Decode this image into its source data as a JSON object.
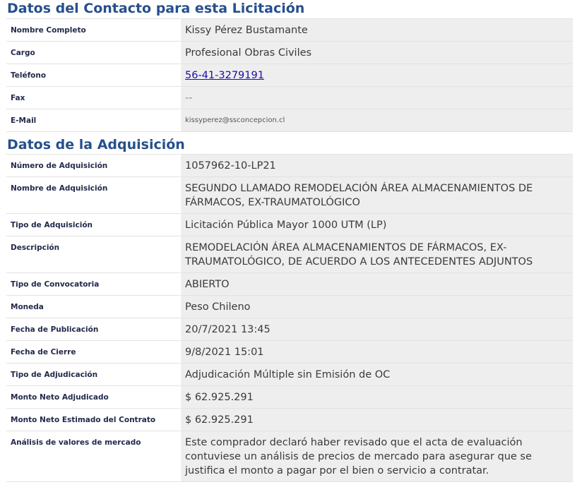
{
  "contact": {
    "title": "Datos del Contacto para esta Licitación",
    "rows": [
      {
        "label": "Nombre Completo",
        "value": "Kissy Pérez Bustamante"
      },
      {
        "label": "Cargo",
        "value": "Profesional Obras Civiles"
      },
      {
        "label": "Teléfono",
        "value": "56-41-3279191"
      },
      {
        "label": "Fax",
        "value": "--"
      },
      {
        "label": "E-Mail",
        "value": "kissyperez@ssconcepcion.cl"
      }
    ]
  },
  "acquisition": {
    "title": "Datos de la Adquisición",
    "rows": [
      {
        "label": "Número de Adquisición",
        "value": "1057962-10-LP21"
      },
      {
        "label": "Nombre de Adquisición",
        "value": "SEGUNDO LLAMADO REMODELACIÓN ÁREA ALMACENAMIENTOS DE FÁRMACOS, EX-TRAUMATOLÓGICO"
      },
      {
        "label": "Tipo de Adquisición",
        "value": "Licitación Pública Mayor 1000 UTM (LP)"
      },
      {
        "label": "Descripción",
        "value": "REMODELACIÓN ÁREA ALMACENAMIENTOS DE FÁRMACOS, EX-TRAUMATOLÓGICO, DE ACUERDO A LOS ANTECEDENTES ADJUNTOS"
      },
      {
        "label": "Tipo de Convocatoria",
        "value": "ABIERTO"
      },
      {
        "label": "Moneda",
        "value": "Peso Chileno"
      },
      {
        "label": "Fecha de Publicación",
        "value": "20/7/2021 13:45"
      },
      {
        "label": "Fecha de Cierre",
        "value": "9/8/2021 15:01"
      },
      {
        "label": "Tipo de Adjudicación",
        "value": "Adjudicación Múltiple sin Emisión de OC"
      },
      {
        "label": "Monto Neto Adjudicado",
        "value": "$ 62.925.291"
      },
      {
        "label": "Monto Neto Estimado del Contrato",
        "value": "$ 62.925.291"
      },
      {
        "label": "Análisis de valores de mercado",
        "value": "Este comprador declaró haber revisado que el acta de evaluación contuviese un análisis de precios de mercado para asegurar que se justifica el monto a pagar por el bien o servicio a contratar."
      }
    ]
  }
}
